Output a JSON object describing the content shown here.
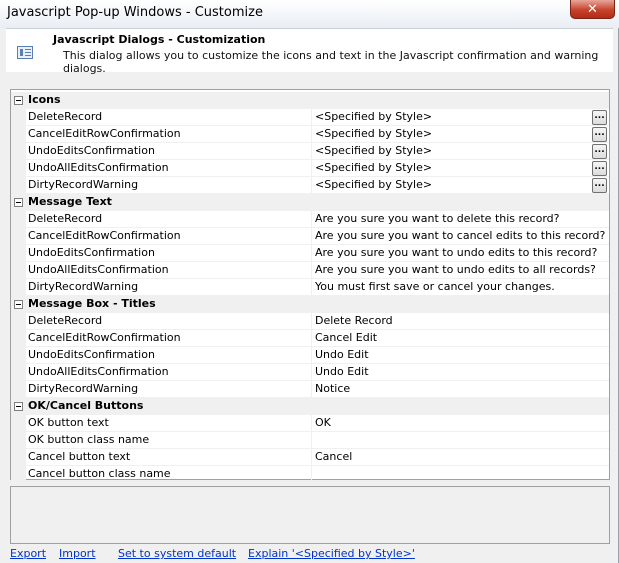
{
  "window": {
    "title": "Javascript Pop-up Windows - Customize",
    "close_label": "✕"
  },
  "header": {
    "icon": "dialog-settings-icon",
    "title": "Javascript Dialogs - Customization",
    "description": "This dialog allows you to customize the icons and text in the Javascript confirmation and warning dialogs."
  },
  "groups": [
    {
      "label": "Icons",
      "rows": [
        {
          "name": "DeleteRecord",
          "value": "<Specified by Style>",
          "has_button": true
        },
        {
          "name": "CancelEditRowConfirmation",
          "value": "<Specified by Style>",
          "has_button": true
        },
        {
          "name": "UndoEditsConfirmation",
          "value": "<Specified by Style>",
          "has_button": true
        },
        {
          "name": "UndoAllEditsConfirmation",
          "value": "<Specified by Style>",
          "has_button": true
        },
        {
          "name": "DirtyRecordWarning",
          "value": "<Specified by Style>",
          "has_button": true
        }
      ]
    },
    {
      "label": "Message Text",
      "rows": [
        {
          "name": "DeleteRecord",
          "value": "Are you sure you want to delete this record?"
        },
        {
          "name": "CancelEditRowConfirmation",
          "value": "Are you sure you want to cancel edits to this record?"
        },
        {
          "name": "UndoEditsConfirmation",
          "value": "Are you sure you want to undo edits to this record?"
        },
        {
          "name": "UndoAllEditsConfirmation",
          "value": "Are you sure you want to undo edits to all records?"
        },
        {
          "name": "DirtyRecordWarning",
          "value": "You must first save or cancel your changes."
        }
      ]
    },
    {
      "label": "Message Box - Titles",
      "rows": [
        {
          "name": "DeleteRecord",
          "value": "Delete Record"
        },
        {
          "name": "CancelEditRowConfirmation",
          "value": "Cancel Edit"
        },
        {
          "name": "UndoEditsConfirmation",
          "value": "Undo Edit"
        },
        {
          "name": "UndoAllEditsConfirmation",
          "value": "Undo Edit"
        },
        {
          "name": "DirtyRecordWarning",
          "value": "Notice"
        }
      ]
    },
    {
      "label": "OK/Cancel Buttons",
      "rows": [
        {
          "name": "OK button text",
          "value": "OK"
        },
        {
          "name": "OK button class name",
          "value": ""
        },
        {
          "name": "Cancel button text",
          "value": "Cancel"
        },
        {
          "name": "Cancel button class name",
          "value": ""
        }
      ]
    }
  ],
  "ellipsis_label": "...",
  "footer": {
    "links": [
      "Export",
      "Import",
      "Set to system default",
      "Explain '<Specified by Style>'"
    ]
  }
}
